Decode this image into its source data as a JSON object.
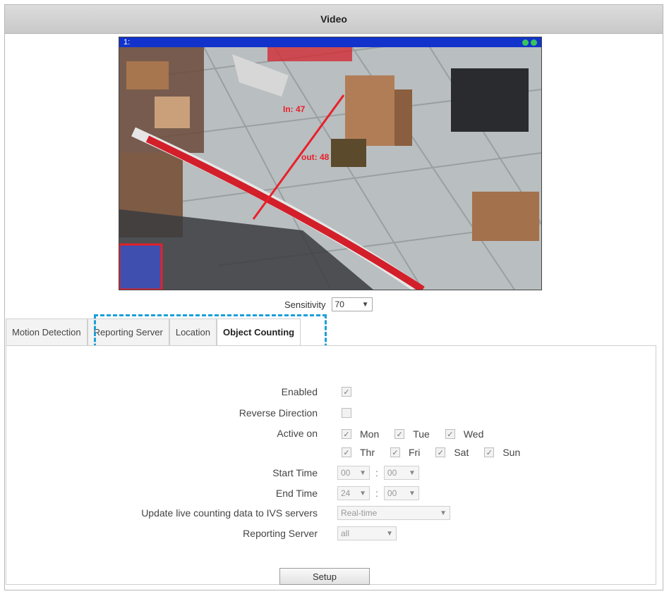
{
  "window": {
    "title": "Video"
  },
  "video": {
    "menu_glyph": "1:",
    "overlay_in": "In: 47",
    "overlay_out": "out: 48"
  },
  "sensitivity": {
    "label": "Sensitivity",
    "value": "70"
  },
  "tabs": [
    {
      "label": "Motion Detection",
      "active": false
    },
    {
      "label": "Reporting Server",
      "active": false
    },
    {
      "label": "Location",
      "active": false
    },
    {
      "label": "Object Counting",
      "active": true
    }
  ],
  "form": {
    "enabled": {
      "label": "Enabled",
      "checked": true
    },
    "reverse": {
      "label": "Reverse Direction",
      "checked": false
    },
    "active_on": {
      "label": "Active on",
      "days": [
        {
          "name": "Mon",
          "checked": true
        },
        {
          "name": "Tue",
          "checked": true
        },
        {
          "name": "Wed",
          "checked": true
        },
        {
          "name": "Thr",
          "checked": true
        },
        {
          "name": "Fri",
          "checked": true
        },
        {
          "name": "Sat",
          "checked": true
        },
        {
          "name": "Sun",
          "checked": true
        }
      ]
    },
    "start_time": {
      "label": "Start Time",
      "hour": "00",
      "minute": "00"
    },
    "end_time": {
      "label": "End Time",
      "hour": "24",
      "minute": "00"
    },
    "update_live": {
      "label": "Update live counting data to IVS servers",
      "value": "Real-time"
    },
    "reporting_server": {
      "label": "Reporting Server",
      "value": "all"
    }
  },
  "setup_button": {
    "label": "Setup"
  },
  "colors": {
    "highlight": "#1aa0d8",
    "titlebar": "#cfcfcf",
    "video_bar": "#1133cc",
    "counting_line": "#e8202a"
  },
  "icons": {
    "check": "checkmark-icon",
    "dropdown": "chevron-down-icon"
  }
}
